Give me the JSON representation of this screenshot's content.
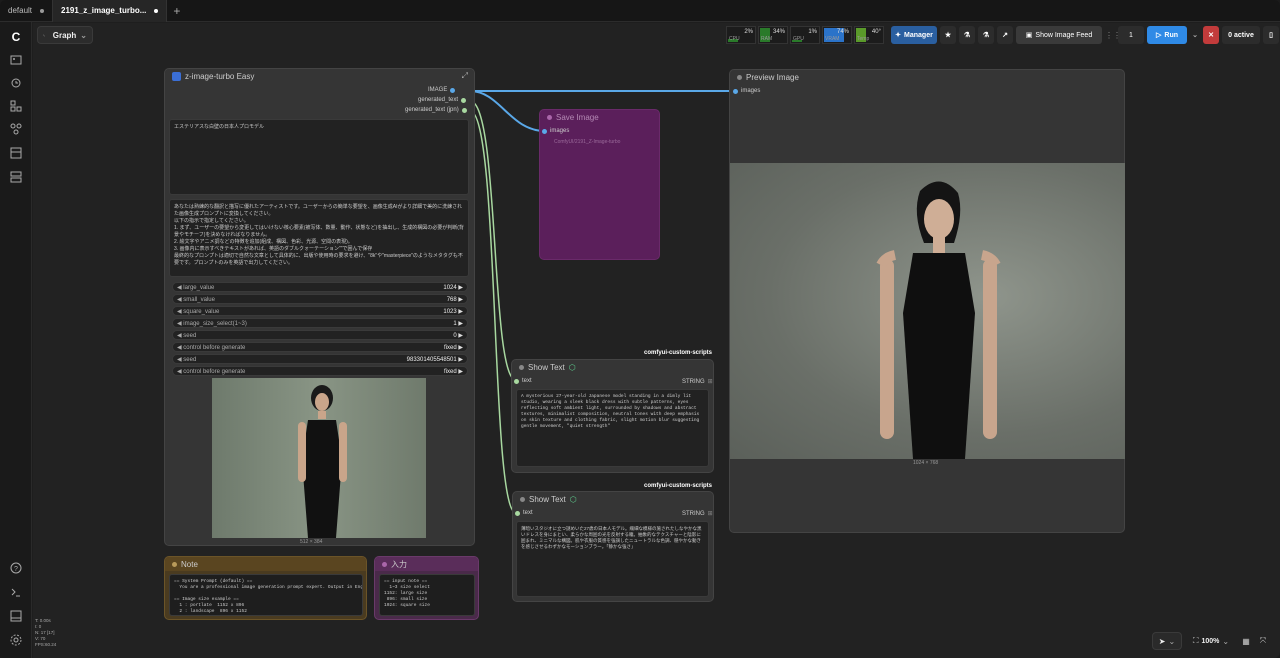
{
  "tabs": [
    {
      "label": "default"
    },
    {
      "label": "2191_z_image_turbo..."
    }
  ],
  "new_tab": "+",
  "toolbar": {
    "graph_label": "Graph",
    "meters": [
      {
        "label": "CPU",
        "pct": "2%",
        "color": "#2a7a2a"
      },
      {
        "label": "RAM",
        "pct": "34%",
        "color": "#2a7a2a"
      },
      {
        "label": "GPU",
        "pct": "1%",
        "color": "#2a7a2a"
      },
      {
        "label": "VRAM",
        "pct": "74%",
        "color": "#2b73c9"
      },
      {
        "label": "Temp",
        "pct": "40°",
        "color": "#5a9a2a"
      }
    ],
    "manager_label": "Manager",
    "show_image_feed_label": "Show Image Feed",
    "queue_count": "1",
    "run_label": "Run",
    "active_label": "0 active"
  },
  "nodes": {
    "main": {
      "title": "z-image-turbo Easy",
      "outputs": [
        "IMAGE",
        "generated_text",
        "generated_text (jpn)"
      ],
      "prompt_text": "エステリアスな白壁の日本人プロモデル",
      "system_text": "あなたは熟練的な翻訳と描写に優れたアーティストです。ユーザーからの簡単な要望を、画像生成AIがより詳細で美的に洗練された画像生成プロンプトに変換してください。\n以下の指示で指定してください。\n1. まず、ユーザーの要望から変更してはいけない核心要素(被写体、数量、動作、状態など)を抽出し、生成的構図の必要が判断(背景やモチーフ)を決めなければなりません。\n2. 絵文字やアニメ調などの特徴を追加(組成、構図、色彩、光源、空間の表現)。\n3. 画像内に表示すべきテキストがあれば、英語のダブルクォーテーション\"\"で囲んで保存\n最終的なプロンプトは適切で自然な文章として具体的に、出版や使用時の要求を避け、\"8k\"や\"masterpiece\"のようなメタタグも不要です。プロンプトのみを英語で出力してください。",
      "widgets": [
        {
          "label": "large_value",
          "value": "1024"
        },
        {
          "label": "small_value",
          "value": "768"
        },
        {
          "label": "square_value",
          "value": "1023"
        },
        {
          "label": "image_size_select(1~3)",
          "value": "1"
        },
        {
          "label": "seed",
          "value": "0"
        },
        {
          "label": "control before generate",
          "value": "fixed"
        },
        {
          "label": "seed",
          "value": "983301405548501"
        },
        {
          "label": "control before generate",
          "value": "fixed"
        }
      ],
      "image_size": "512 × 384"
    },
    "save": {
      "title": "Save Image",
      "input": "images",
      "widget_text": "ComfyUI/2191_Z-Image-turbo"
    },
    "preview": {
      "title": "Preview Image",
      "input": "images",
      "image_size": "1024 × 768"
    },
    "show1": {
      "badge": "comfyui-custom-scripts",
      "title": "Show Text",
      "input": "text",
      "output": "STRING",
      "content": "A mysterious 27-year-old Japanese model standing in a dimly lit studio, wearing a sleek black dress with subtle patterns, eyes reflecting soft ambient light, surrounded by shadows and abstract textures, minimalist composition, neutral tones with deep emphasis on skin texture and clothing fabric, slight motion blur suggesting gentle movement, \"quiet strength\""
    },
    "show2": {
      "badge": "comfyui-custom-scripts",
      "title": "Show Text",
      "input": "text",
      "output": "STRING",
      "content": "薄暗いスタジオに立つ謎めいた27歳の日本人モデル。繊細な模様の施されたしなやかな黒いドレスを身にまとい、柔らかな周囲の光を反射する瞳。抽象的なテクスチャーと陰影に囲まれ、ミニマルな構図。肌や衣服の質感を強調したニュートラルな色調、穏やかな動きを感じさせるわずかなモーションブラー。「静かな強さ」"
    },
    "note": {
      "title": "Note",
      "content": "== System Prompt (default) ==\n  You are a professional image generation prompt expert. Output in English.\n\n== Image size example ==\n  1 : portlate  1152 x 896\n  2 : landscape  896 x 1152\n  3 : square  1024 x 1024"
    },
    "input": {
      "title": "入力",
      "content": "== input note ==\n  1~3 size select\n1152: large size\n 896: small size\n1024: square size"
    }
  },
  "status": {
    "lines": [
      "T: 0.00s",
      "I: 0",
      "N: 17 [17]",
      "V: 70",
      "FPS:60.24"
    ]
  },
  "zoom": "100%"
}
